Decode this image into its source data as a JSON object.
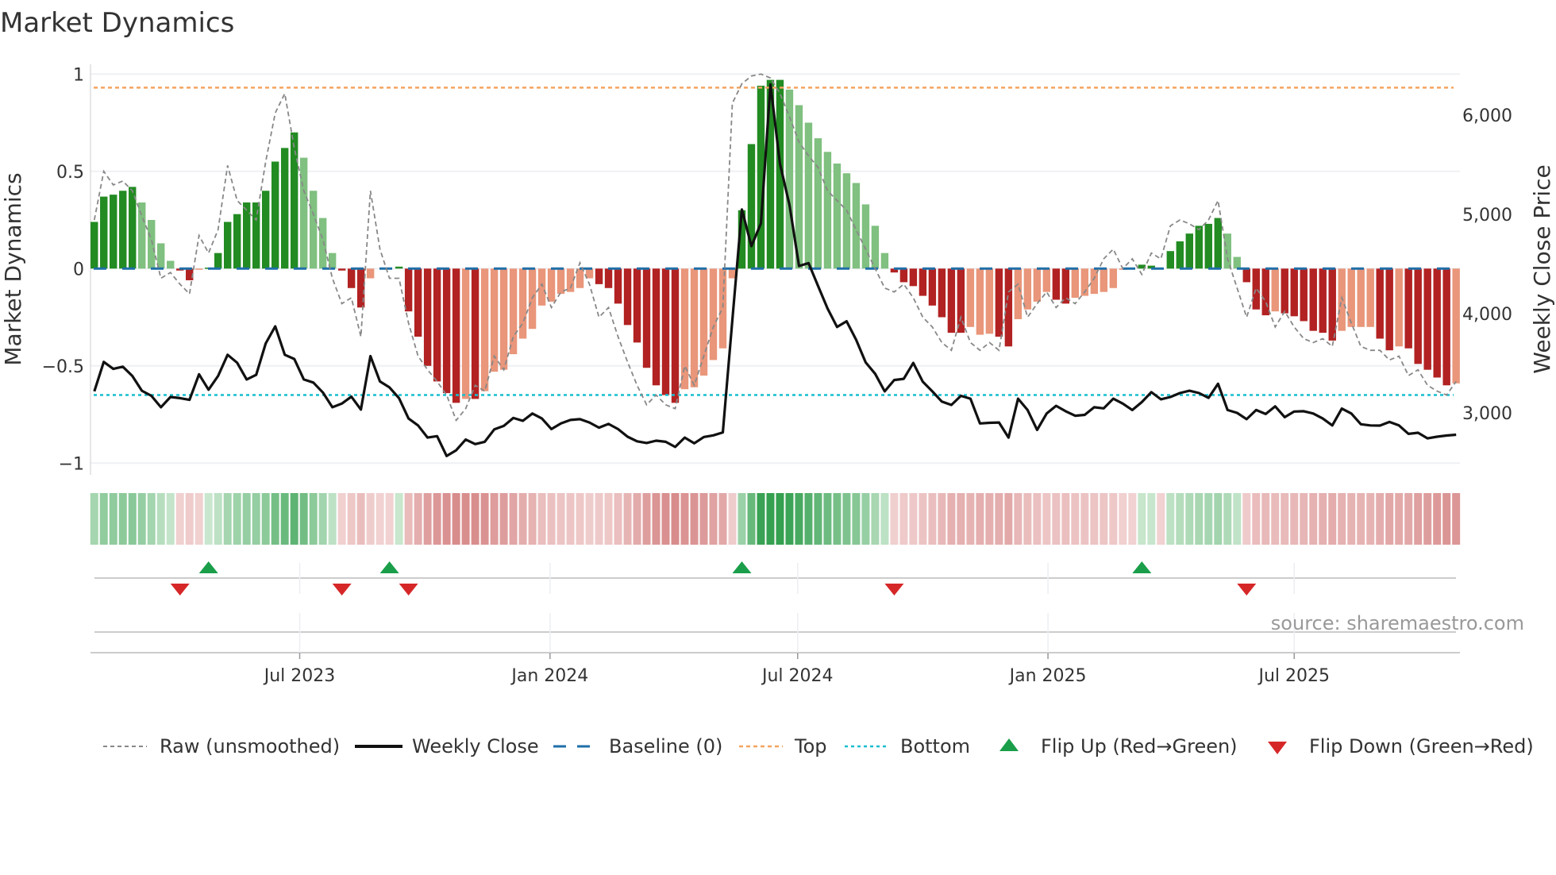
{
  "chart_data": {
    "type": "bar",
    "title": "Market Dynamics",
    "ylabel": "Market Dynamics",
    "y2label": "Weekly Close Price",
    "source": "source: sharemaestro.com",
    "start_date": "2023-01-31",
    "frequency": "weekly",
    "ylim": [
      -1.06,
      1.05
    ],
    "y2lim": [
      2376,
      6512
    ],
    "yticks": [
      {
        "v": 1,
        "label": "1"
      },
      {
        "v": 0.5,
        "label": "0.5"
      },
      {
        "v": 0,
        "label": "0"
      },
      {
        "v": -0.5,
        "label": "−0.5"
      },
      {
        "v": -1,
        "label": "−1"
      }
    ],
    "y2ticks": [
      {
        "v": 6000,
        "label": "6,000"
      },
      {
        "v": 5000,
        "label": "5,000"
      },
      {
        "v": 4000,
        "label": "4,000"
      },
      {
        "v": 3000,
        "label": "3,000"
      }
    ],
    "xticks": [
      {
        "date": "2023-07-01",
        "label": "Jul 2023"
      },
      {
        "date": "2024-01-01",
        "label": "Jan 2024"
      },
      {
        "date": "2024-07-01",
        "label": "Jul 2024"
      },
      {
        "date": "2025-01-01",
        "label": "Jan 2025"
      },
      {
        "date": "2025-07-01",
        "label": "Jul 2025"
      }
    ],
    "top_level": 0.93,
    "bottom_level": -0.65,
    "baseline": 0,
    "colors": {
      "G": "#228b22",
      "g": "#80c080",
      "R": "#b22222",
      "r": "#e9967a",
      "raw": "#888888",
      "close": "#111111",
      "baseline": "#1f6fa8",
      "top": "#f4a460",
      "bottom": "#17becf",
      "flip_up": "#1a9e4a",
      "flip_down": "#d62728"
    },
    "dynamics": [
      0.24,
      0.37,
      0.38,
      0.4,
      0.42,
      0.34,
      0.25,
      0.13,
      0.04,
      -0.01,
      -0.06,
      -0.005,
      0.005,
      0.08,
      0.24,
      0.28,
      0.34,
      0.34,
      0.4,
      0.55,
      0.62,
      0.7,
      0.57,
      0.4,
      0.26,
      0.08,
      -0.01,
      -0.1,
      -0.2,
      -0.05,
      0,
      0,
      0.01,
      -0.22,
      -0.35,
      -0.5,
      -0.58,
      -0.64,
      -0.69,
      -0.67,
      -0.67,
      -0.63,
      -0.53,
      -0.52,
      -0.44,
      -0.36,
      -0.31,
      -0.19,
      -0.17,
      -0.13,
      -0.12,
      -0.1,
      -0.05,
      -0.08,
      -0.1,
      -0.18,
      -0.29,
      -0.38,
      -0.51,
      -0.6,
      -0.65,
      -0.69,
      -0.62,
      -0.61,
      -0.55,
      -0.47,
      -0.41,
      -0.05,
      0.3,
      0.64,
      0.94,
      0.97,
      0.97,
      0.92,
      0.84,
      0.75,
      0.67,
      0.6,
      0.54,
      0.49,
      0.44,
      0.33,
      0.22,
      0.08,
      -0.02,
      -0.07,
      -0.09,
      -0.14,
      -0.19,
      -0.25,
      -0.33,
      -0.33,
      -0.3,
      -0.34,
      -0.335,
      -0.35,
      -0.4,
      -0.26,
      -0.21,
      -0.17,
      -0.12,
      -0.16,
      -0.18,
      -0.15,
      -0.14,
      -0.13,
      -0.12,
      -0.1,
      -0.005,
      0,
      0.02,
      0.015,
      0,
      0.09,
      0.14,
      0.18,
      0.22,
      0.23,
      0.26,
      0.18,
      0.06,
      -0.07,
      -0.21,
      -0.24,
      -0.22,
      -0.23,
      -0.245,
      -0.27,
      -0.32,
      -0.33,
      -0.37,
      -0.32,
      -0.3,
      -0.3,
      -0.3,
      -0.36,
      -0.42,
      -0.4,
      -0.41,
      -0.49,
      -0.52,
      -0.56,
      -0.6,
      -0.59
    ],
    "states": "GGGGGggggRRrGGGGGGGGGGggggRRRr  GRRRRRRrRrrrrrrrrrrrrRRRRRRRRRrrrrrrGGGGGgggggggggggRRRRRRRRrrrRRrrrrRRrrrrrr GG GGGGGGggRRRrRRRRRRrrrrRRrRRRRRr",
    "raw": [
      0.25,
      0.5,
      0.43,
      0.45,
      0.4,
      0.27,
      0.15,
      -0.05,
      -0.02,
      -0.08,
      -0.13,
      0.17,
      0.08,
      0.2,
      0.53,
      0.35,
      0.3,
      0.25,
      0.55,
      0.8,
      0.9,
      0.62,
      0.4,
      0.28,
      0.15,
      -0.05,
      -0.18,
      -0.15,
      -0.35,
      0.4,
      0.1,
      -0.05,
      -0.05,
      -0.28,
      -0.45,
      -0.52,
      -0.58,
      -0.65,
      -0.78,
      -0.72,
      -0.6,
      -0.63,
      -0.45,
      -0.52,
      -0.35,
      -0.28,
      -0.15,
      -0.08,
      -0.2,
      -0.12,
      -0.1,
      0.03,
      -0.08,
      -0.25,
      -0.2,
      -0.35,
      -0.48,
      -0.6,
      -0.7,
      -0.65,
      -0.7,
      -0.72,
      -0.5,
      -0.6,
      -0.45,
      -0.3,
      -0.2,
      0.85,
      0.95,
      0.99,
      1.0,
      0.98,
      0.9,
      0.78,
      0.65,
      0.58,
      0.52,
      0.4,
      0.35,
      0.3,
      0.2,
      0.1,
      0.0,
      -0.1,
      -0.12,
      -0.08,
      -0.15,
      -0.25,
      -0.3,
      -0.38,
      -0.42,
      -0.25,
      -0.38,
      -0.42,
      -0.38,
      -0.42,
      -0.12,
      -0.08,
      -0.25,
      -0.18,
      -0.12,
      -0.2,
      -0.15,
      -0.18,
      -0.12,
      -0.05,
      0.05,
      0.1,
      0.0,
      0.05,
      -0.03,
      0.08,
      0.05,
      0.22,
      0.25,
      0.23,
      0.2,
      0.25,
      0.35,
      0.05,
      -0.1,
      -0.25,
      -0.1,
      -0.17,
      -0.3,
      -0.22,
      -0.3,
      -0.36,
      -0.38,
      -0.36,
      -0.4,
      -0.15,
      -0.28,
      -0.4,
      -0.42,
      -0.42,
      -0.47,
      -0.45,
      -0.55,
      -0.52,
      -0.6,
      -0.63,
      -0.65,
      -0.58
    ],
    "close": [
      3217,
      3514,
      3443,
      3466,
      3372,
      3223,
      3172,
      3057,
      3160,
      3149,
      3131,
      3389,
      3234,
      3372,
      3586,
      3506,
      3337,
      3383,
      3700,
      3872,
      3586,
      3543,
      3337,
      3306,
      3206,
      3057,
      3094,
      3163,
      3034,
      3572,
      3317,
      3257,
      3149,
      2943,
      2874,
      2751,
      2766,
      2566,
      2623,
      2731,
      2686,
      2709,
      2834,
      2869,
      2949,
      2920,
      2994,
      2943,
      2837,
      2894,
      2929,
      2937,
      2903,
      2851,
      2889,
      2837,
      2760,
      2714,
      2697,
      2720,
      2709,
      2657,
      2751,
      2694,
      2757,
      2774,
      2803,
      3935,
      5050,
      4680,
      4909,
      6309,
      5509,
      5094,
      4480,
      4509,
      4280,
      4052,
      3866,
      3923,
      3737,
      3509,
      3394,
      3217,
      3331,
      3343,
      3503,
      3314,
      3217,
      3114,
      3080,
      3172,
      3143,
      2894,
      2900,
      2903,
      2751,
      3143,
      3029,
      2829,
      2994,
      3071,
      3017,
      2971,
      2980,
      3057,
      3046,
      3143,
      3094,
      3029,
      3109,
      3209,
      3137,
      3160,
      3200,
      3223,
      3200,
      3151,
      3294,
      3029,
      3000,
      2937,
      3029,
      2989,
      3066,
      2957,
      3014,
      3017,
      2994,
      2943,
      2874,
      3043,
      2994,
      2886,
      2874,
      2872,
      2909,
      2874,
      2789,
      2800,
      2743,
      2760,
      2772,
      2780
    ],
    "flip_up_weeks": [
      12,
      31,
      68,
      110
    ],
    "flip_down_weeks": [
      9,
      26,
      33,
      84,
      121
    ],
    "legend_position": "bottom",
    "legend": [
      "Raw (unsmoothed)",
      "Weekly Close",
      "Baseline (0)",
      "Top",
      "Bottom",
      "Flip Up (Red→Green)",
      "Flip Down (Green→Red)"
    ]
  }
}
